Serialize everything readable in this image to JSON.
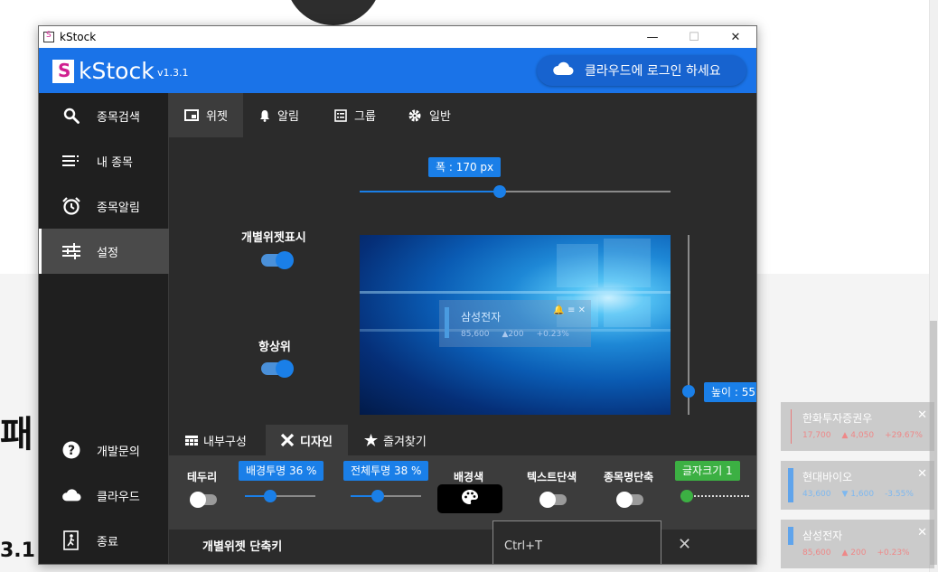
{
  "background": {
    "heading": "패",
    "version_fragment": "3.1"
  },
  "desktop_widgets": [
    {
      "name": "한화투자증권우",
      "price": "17,700",
      "change": "▲ 4,050",
      "rate": "+29.67%",
      "bar_color": "#e87c7c",
      "text_color": "#ee8888"
    },
    {
      "name": "현대바이오",
      "price": "43,600",
      "change": "▼ 1,600",
      "rate": "-3.55%",
      "bar_color": "#5fa4ec",
      "text_color": "#7db8f0"
    },
    {
      "name": "삼성전자",
      "price": "85,600",
      "change": "▲ 200",
      "rate": "+0.23%",
      "bar_color": "#5fa4ec",
      "text_color": "#ee8888"
    }
  ],
  "window": {
    "title": "kStock",
    "controls": {
      "minimize": "—",
      "maximize": "☐",
      "close": "✕"
    }
  },
  "header": {
    "brand": "kStock",
    "version": "v1.3.1",
    "cloud_login": "클라우드에 로그인 하세요"
  },
  "sidebar": {
    "items": [
      {
        "label": "종목검색",
        "icon": "search-icon"
      },
      {
        "label": "내 종목",
        "icon": "list-icon"
      },
      {
        "label": "종목알림",
        "icon": "alarm-clock-icon"
      },
      {
        "label": "설정",
        "icon": "sliders-icon"
      }
    ],
    "bottom": [
      {
        "label": "개발문의",
        "icon": "help-icon"
      },
      {
        "label": "클라우드",
        "icon": "cloud-icon"
      },
      {
        "label": "종료",
        "icon": "exit-icon"
      }
    ]
  },
  "tabs": [
    {
      "label": "위젯",
      "icon": "widget-icon"
    },
    {
      "label": "알림",
      "icon": "bell-icon"
    },
    {
      "label": "그룹",
      "icon": "group-list-icon"
    },
    {
      "label": "일반",
      "icon": "gear-icon"
    }
  ],
  "widget_settings": {
    "individual_widget_label": "개별위젯표시",
    "individual_widget_on": true,
    "always_on_top_label": "항상위",
    "always_on_top_on": true,
    "width_tip": "폭 : 170 px",
    "width_fraction": 0.45,
    "height_tip": "높이 : 55 px",
    "height_fraction": 0.03
  },
  "preview_widget": {
    "name": "삼성전자",
    "price": "85,600",
    "change": "▲200",
    "rate": "+0.23%"
  },
  "subtabs": [
    {
      "label": "내부구성",
      "icon": "grid-icon"
    },
    {
      "label": "디자인",
      "icon": "design-tools-icon"
    },
    {
      "label": "즐겨찾기",
      "icon": "star-icon"
    }
  ],
  "design": {
    "border_label": "테두리",
    "border_on": false,
    "bg_opacity_tip": "배경투명 36 %",
    "bg_opacity_fraction": 0.36,
    "total_opacity_tip": "전체투명 38 %",
    "total_opacity_fraction": 0.38,
    "bg_color_label": "배경색",
    "text_mono_label": "텍스트단색",
    "text_mono_on": false,
    "name_short_label": "종목명단축",
    "name_short_on": false,
    "font_size_tip": "글자크기 1"
  },
  "shortcut": {
    "label": "개별위젯 단축키",
    "value": "Ctrl+T"
  },
  "colors": {
    "accent": "#1a7fe8",
    "header": "#1a73e8",
    "dark_bg": "#2b2b2b",
    "sidebar_bg": "#1f1f1f",
    "font_slider": "#3cb043"
  }
}
